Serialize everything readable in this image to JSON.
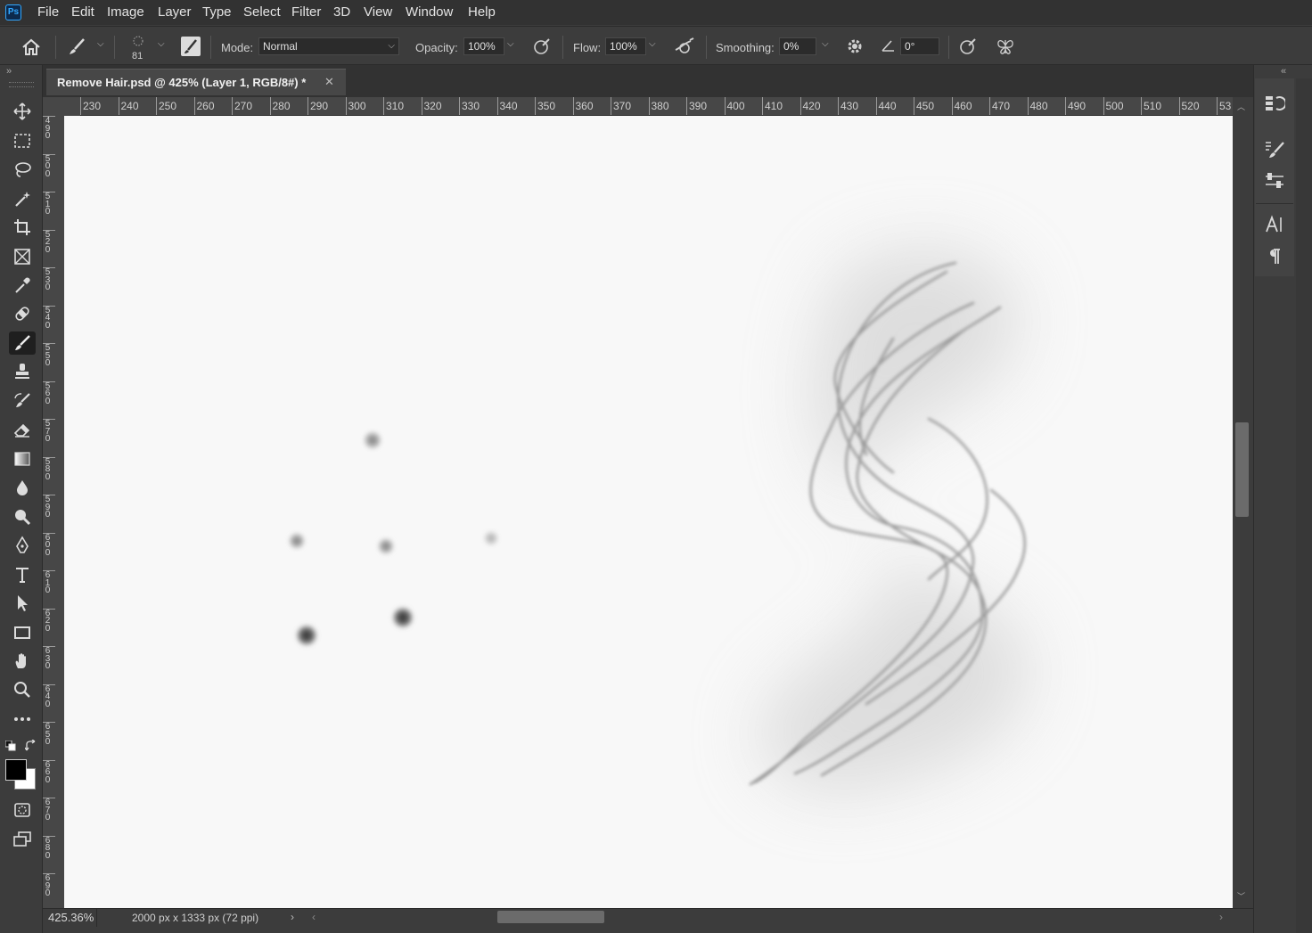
{
  "app": {
    "logo_text": "Ps"
  },
  "menu": [
    "File",
    "Edit",
    "Image",
    "Layer",
    "Type",
    "Select",
    "Filter",
    "3D",
    "View",
    "Window",
    "Help"
  ],
  "options": {
    "brush_size": "81",
    "mode_label": "Mode:",
    "mode_value": "Normal",
    "opacity_label": "Opacity:",
    "opacity_value": "100%",
    "flow_label": "Flow:",
    "flow_value": "100%",
    "smoothing_label": "Smoothing:",
    "smoothing_value": "0%",
    "angle_value": "0°"
  },
  "document": {
    "tab_title": "Remove Hair.psd @ 425% (Layer 1, RGB/8#) *",
    "ruler_ticks": [
      "230",
      "240",
      "250",
      "260",
      "270",
      "280",
      "290",
      "300",
      "310",
      "320",
      "330",
      "340",
      "350",
      "360",
      "370",
      "380",
      "390",
      "400",
      "410",
      "420",
      "430",
      "440",
      "450",
      "460",
      "470",
      "480",
      "490",
      "500",
      "510",
      "520",
      "53"
    ],
    "left_ruler": [
      "490",
      "500",
      "510",
      "520",
      "530",
      "540",
      "550",
      "560",
      "570",
      "580",
      "590",
      "600",
      "610",
      "620",
      "630",
      "640",
      "650",
      "660",
      "670",
      "680",
      "690"
    ]
  },
  "status": {
    "zoom": "425.36%",
    "doc_info": "2000 px x 1333 px (72 ppi)"
  },
  "toolbar_tools": [
    "move-tool",
    "marquee-tool",
    "lasso-tool",
    "magic-wand-tool",
    "crop-tool",
    "frame-tool",
    "eyedropper-tool",
    "healing-brush-tool",
    "brush-tool",
    "clone-stamp-tool",
    "history-brush-tool",
    "eraser-tool",
    "gradient-tool",
    "blur-tool",
    "dodge-tool",
    "pen-tool",
    "type-tool",
    "path-selection-tool",
    "rectangle-tool",
    "hand-tool",
    "zoom-tool",
    "more-tools"
  ],
  "colors": {
    "foreground": "#000000",
    "background": "#ffffff",
    "ui_dark": "#323232",
    "ui_mid": "#3c3c3c",
    "canvas": "#f8f8f8"
  }
}
